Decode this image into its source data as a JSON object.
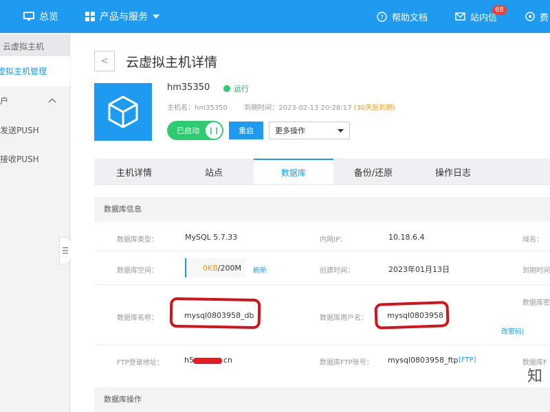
{
  "topbar": {
    "overview": "总览",
    "products": "产品与服务",
    "help": "帮助文档",
    "messages": "站内信",
    "messages_count": "68",
    "fee": "费"
  },
  "sidebar": {
    "section_title": "云虚拟主机",
    "active_item": "虚拟主机管理",
    "group_title": "户",
    "item_send": "发送PUSH",
    "item_receive": "接收PUSH"
  },
  "page": {
    "back": "<",
    "title": "云虚拟主机详情"
  },
  "host": {
    "name": "hm35350",
    "status": "运行",
    "host_label": "主机名：",
    "host_value": "hm35350",
    "expire_label": "到期时间：",
    "expire_value": "2023-02-13 20:28:17",
    "expire_note": "(30天后到期)",
    "toggle_label": "已启动",
    "restart": "重启",
    "more_ops": "更多操作"
  },
  "tabs": [
    "主机详情",
    "站点",
    "数据库",
    "备份/还原",
    "操作日志"
  ],
  "db_info": {
    "section_title": "数据库信息",
    "type_label": "数据库类型：",
    "type_value": "MySQL 5.7.33",
    "ip_label": "内网IP：",
    "ip_value": "10.18.6.4",
    "domain_label": "域名：",
    "space_label": "数据库空间：",
    "space_used": "0KB",
    "space_total": "/200M",
    "refresh": "刷新",
    "created_label": "创建时间：",
    "created_value": "2023年01月13日",
    "expire_label_r": "到期时间",
    "dbname_label": "数据库名称：",
    "dbname_value": "mysql0803958_db",
    "user_label": "数据库用户名：",
    "user_value": "mysql0803958",
    "pwd_label": "数据库密",
    "change_pwd": "改密码|",
    "ftp_label": "FTP登录地址：",
    "ftp_prefix": "h5",
    "ftp_suffix": "cn",
    "ftp_account_label": "数据库FTP账号：",
    "ftp_account_value": "mysql0803958_ftp",
    "ftp_link": "[FTP]",
    "ftp_r_label": "数据库F"
  },
  "db_ops": {
    "section_title": "数据库操作"
  },
  "watermark": "知"
}
